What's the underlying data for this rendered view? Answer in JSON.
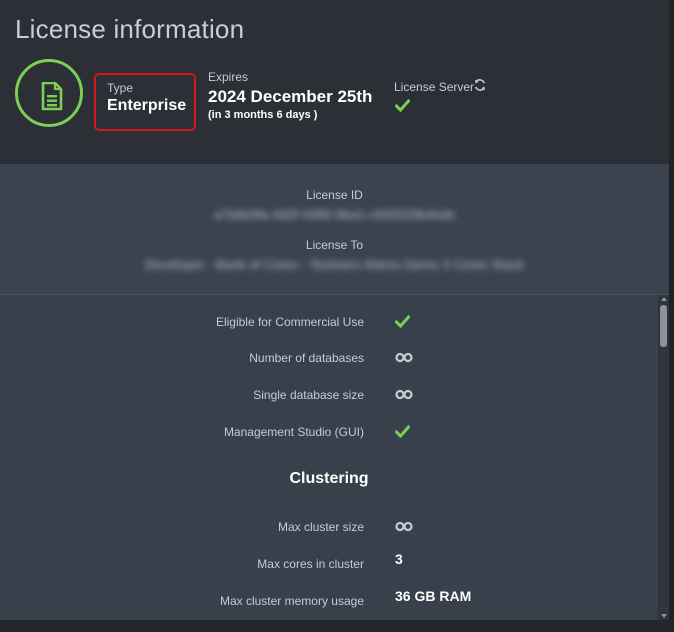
{
  "header": {
    "title": "License information",
    "type_label": "Type",
    "type_value": "Enterprise",
    "expires_label": "Expires",
    "expires_date": "2024 December 25th",
    "expires_relative": "(in 3 months 6 days )",
    "license_server_label": "License Server",
    "license_server_status": "check-icon",
    "document_icon": "document-icon",
    "refresh_icon": "refresh-icon"
  },
  "details": {
    "license_id_label": "License ID",
    "license_id_value": "a7b8e9fa-4d2f-4386-9ba1-c932033b4ede",
    "license_to_label": "License To",
    "license_to_value": "Developer - Bank of Cores - Testivers Alamo Demo 3 Cores Stack"
  },
  "features": {
    "commercial_label": "Eligible for Commercial Use",
    "databases_label": "Number of databases",
    "db_size_label": "Single database size",
    "studio_label": "Management Studio (GUI)",
    "clustering_title": "Clustering",
    "max_cluster_label": "Max cluster size",
    "max_cores_label": "Max cores in cluster",
    "max_cores_value": "3",
    "max_memory_label": "Max cluster memory usage",
    "max_memory_value": "36 GB RAM"
  },
  "colors": {
    "accent_green": "#7ccf56",
    "highlight_red": "#d01820"
  }
}
